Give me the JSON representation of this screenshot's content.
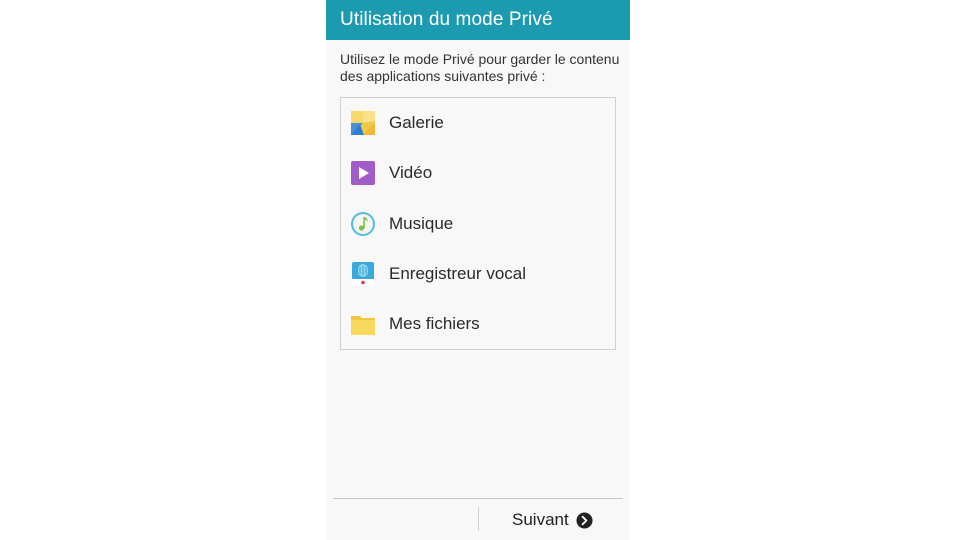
{
  "header": {
    "title": "Utilisation du mode Privé"
  },
  "description": "Utilisez le mode Privé pour garder le contenu des applications suivantes privé :",
  "apps": [
    {
      "label": "Galerie",
      "icon": "gallery-icon"
    },
    {
      "label": "Vidéo",
      "icon": "video-icon"
    },
    {
      "label": "Musique",
      "icon": "music-icon"
    },
    {
      "label": "Enregistreur vocal",
      "icon": "voice-recorder-icon"
    },
    {
      "label": "Mes fichiers",
      "icon": "folder-icon"
    }
  ],
  "footer": {
    "next_label": "Suivant",
    "next_icon": "chevron-right-circle-icon"
  },
  "colors": {
    "header_bg": "#1c9bb0",
    "page_bg": "#f8f8f8"
  }
}
